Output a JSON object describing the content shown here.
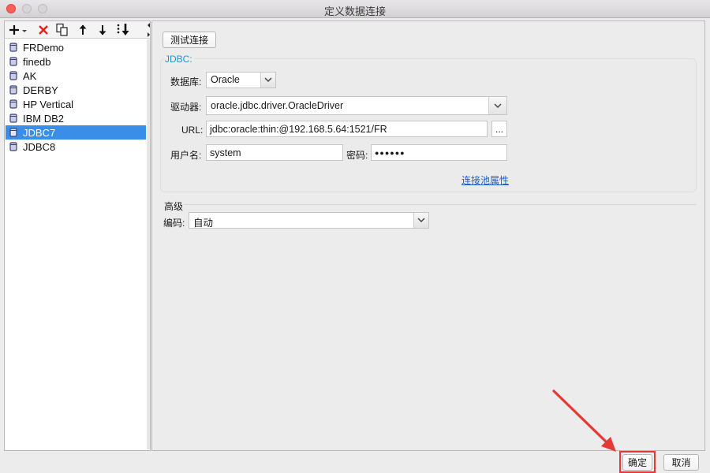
{
  "window": {
    "title": "定义数据连接"
  },
  "list": {
    "items": [
      {
        "label": "FRDemo",
        "selected": false
      },
      {
        "label": "finedb",
        "selected": false
      },
      {
        "label": "AK",
        "selected": false
      },
      {
        "label": "DERBY",
        "selected": false
      },
      {
        "label": "HP Vertical",
        "selected": false
      },
      {
        "label": "IBM DB2",
        "selected": false
      },
      {
        "label": "JDBC7",
        "selected": true
      },
      {
        "label": "JDBC8",
        "selected": false
      }
    ]
  },
  "toolbar": {
    "icons": [
      "add-dropdown-icon",
      "delete-icon",
      "copy-icon",
      "move-up-icon",
      "move-down-icon",
      "sort-icon"
    ]
  },
  "main": {
    "test_button": "测试连接",
    "group_title": "JDBC:",
    "database_label": "数据库:",
    "database_value": "Oracle",
    "driver_label": "驱动器:",
    "driver_value": "oracle.jdbc.driver.OracleDriver",
    "url_label": "URL:",
    "url_value": "jdbc:oracle:thin:@192.168.5.64:1521/FR",
    "url_browse": "...",
    "username_label": "用户名:",
    "username_value": "system",
    "password_label": "密码:",
    "password_value": "●●●●●●",
    "pool_link": "连接池属性",
    "advanced_title": "高级",
    "encoding_label": "编码:",
    "encoding_value": "自动"
  },
  "footer": {
    "ok_button": "确定",
    "cancel_button": "取消"
  },
  "colors": {
    "selection": "#3b8ee8",
    "group_title": "#2196c9",
    "link": "#1b5ccf",
    "annotation": "#e53935"
  }
}
